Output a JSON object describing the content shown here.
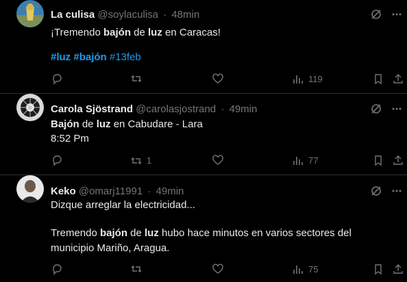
{
  "tweets": [
    {
      "name": "La culisa",
      "handle": "@soylaculisa",
      "time": "48min",
      "line1": {
        "a": "¡Tremendo ",
        "b": "bajón",
        "c": " de ",
        "d": "luz",
        "e": " en Caracas!"
      },
      "hashtags": [
        "#luz",
        "#bajón",
        "#13feb"
      ],
      "reply_count": "",
      "retweet_count": "",
      "like_count": "",
      "views": "119"
    },
    {
      "name": "Carola Sjöstrand",
      "handle": "@carolasjostrand",
      "time": "49min",
      "line1": {
        "a": "Bajón",
        "b": " de ",
        "c": "luz",
        "d": " en Cabudare - Lara"
      },
      "line2": "8:52 Pm",
      "reply_count": "",
      "retweet_count": "1",
      "like_count": "",
      "views": "77"
    },
    {
      "name": "Keko",
      "handle": "@omarj11991",
      "time": "49min",
      "line1": "Dizque arreglar la electricidad...",
      "line2": {
        "a": "Tremendo ",
        "b": "bajón",
        "c": " de ",
        "d": "luz",
        "e": " hubo hace minutos en varios sectores del"
      },
      "line3": "municipio Mariño, Aragua.",
      "reply_count": "",
      "retweet_count": "",
      "like_count": "",
      "views": "75"
    }
  ],
  "colors": {
    "background": "#000000",
    "text": "#e7e9ea",
    "muted": "#71767b",
    "link": "#1d9bf0",
    "divider": "#2f3336"
  },
  "icons": [
    "grok-icon",
    "more-icon",
    "reply-icon",
    "retweet-icon",
    "like-icon",
    "views-icon",
    "bookmark-icon",
    "share-icon"
  ]
}
